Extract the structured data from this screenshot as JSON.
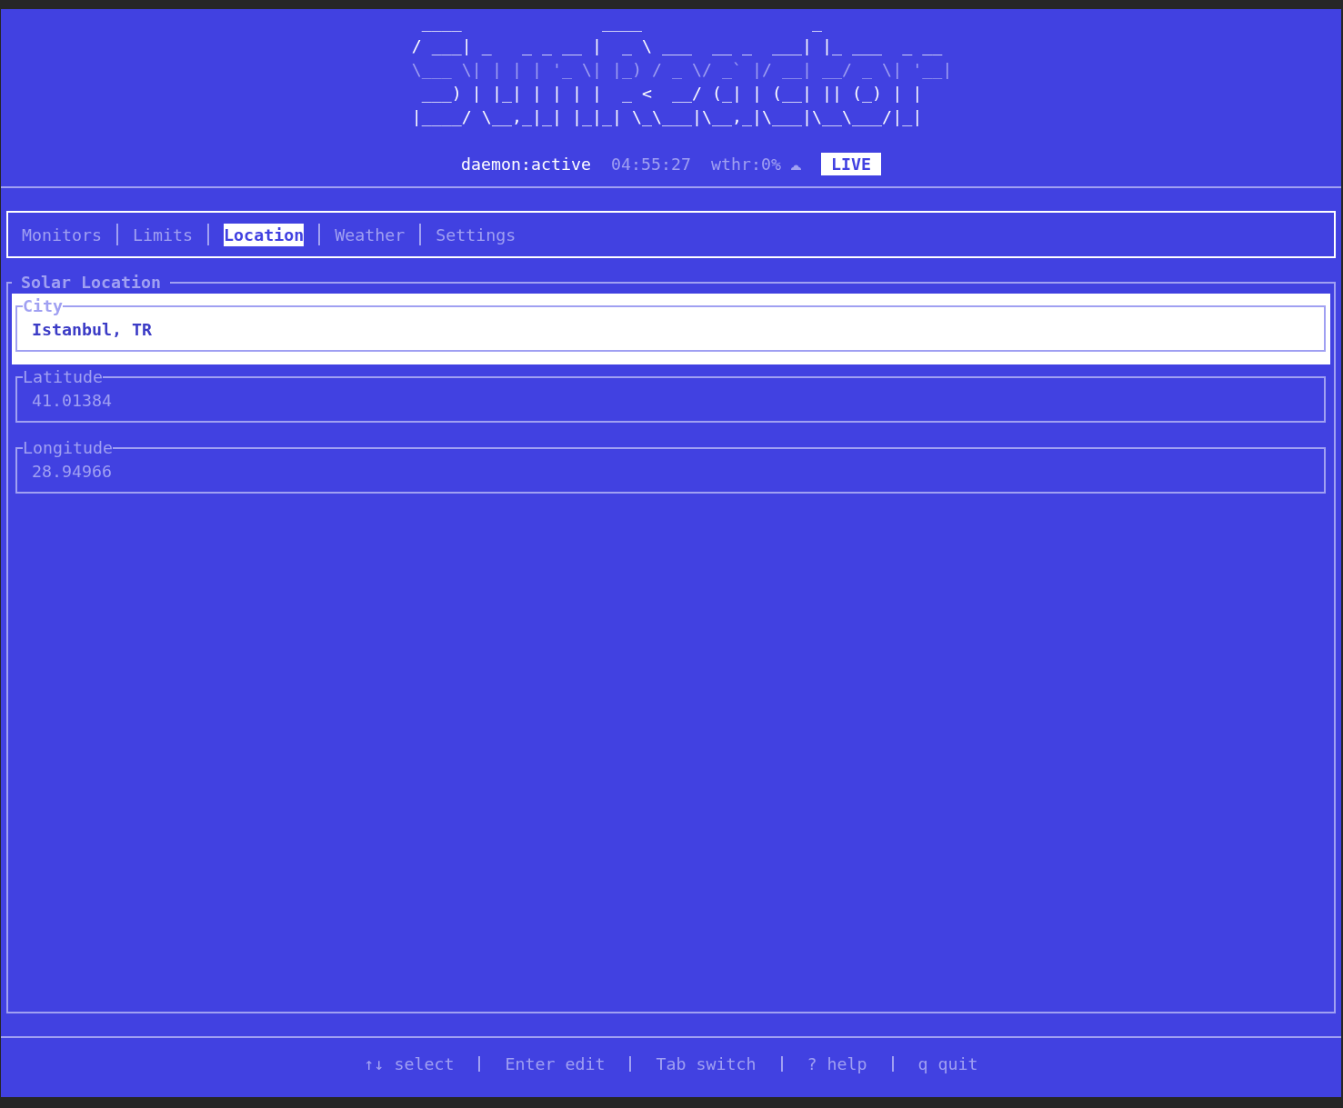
{
  "logo": {
    "lines": [
      {
        "text": " ____              ____                 _",
        "dim": false
      },
      {
        "text": "/ ___| _   _ _ __ |  _ \\ ___  __ _  ___| |_ ___  _ __",
        "dim": false
      },
      {
        "text": "\\___ \\| | | | '_ \\| |_) / _ \\/ _` |/ __| __/ _ \\| '__|",
        "dim": true
      },
      {
        "text": " ___) | |_| | | | |  _ <  __/ (_| | (__| || (_) | |",
        "dim": false
      },
      {
        "text": "|____/ \\__,_|_| |_|_| \\_\\___|\\__,_|\\___|\\__\\___/|_|",
        "dim": false
      }
    ]
  },
  "status": {
    "daemon": "daemon:active",
    "clock": "04:55:27",
    "weather": "wthr:0%",
    "badge": "LIVE"
  },
  "tabs": [
    {
      "label": "Monitors",
      "selected": false
    },
    {
      "label": "Limits",
      "selected": false
    },
    {
      "label": "Location",
      "selected": true
    },
    {
      "label": "Weather",
      "selected": false
    },
    {
      "label": "Settings",
      "selected": false
    }
  ],
  "panel": {
    "title": "Solar Location",
    "fields": [
      {
        "label": "City",
        "value": "Istanbul, TR",
        "selected": true
      },
      {
        "label": "Latitude",
        "value": "41.01384",
        "selected": false
      },
      {
        "label": "Longitude",
        "value": "28.94966",
        "selected": false
      }
    ]
  },
  "footer": {
    "hints": [
      "↑↓ select",
      "Enter edit",
      "Tab switch",
      "? help",
      "q quit"
    ]
  }
}
